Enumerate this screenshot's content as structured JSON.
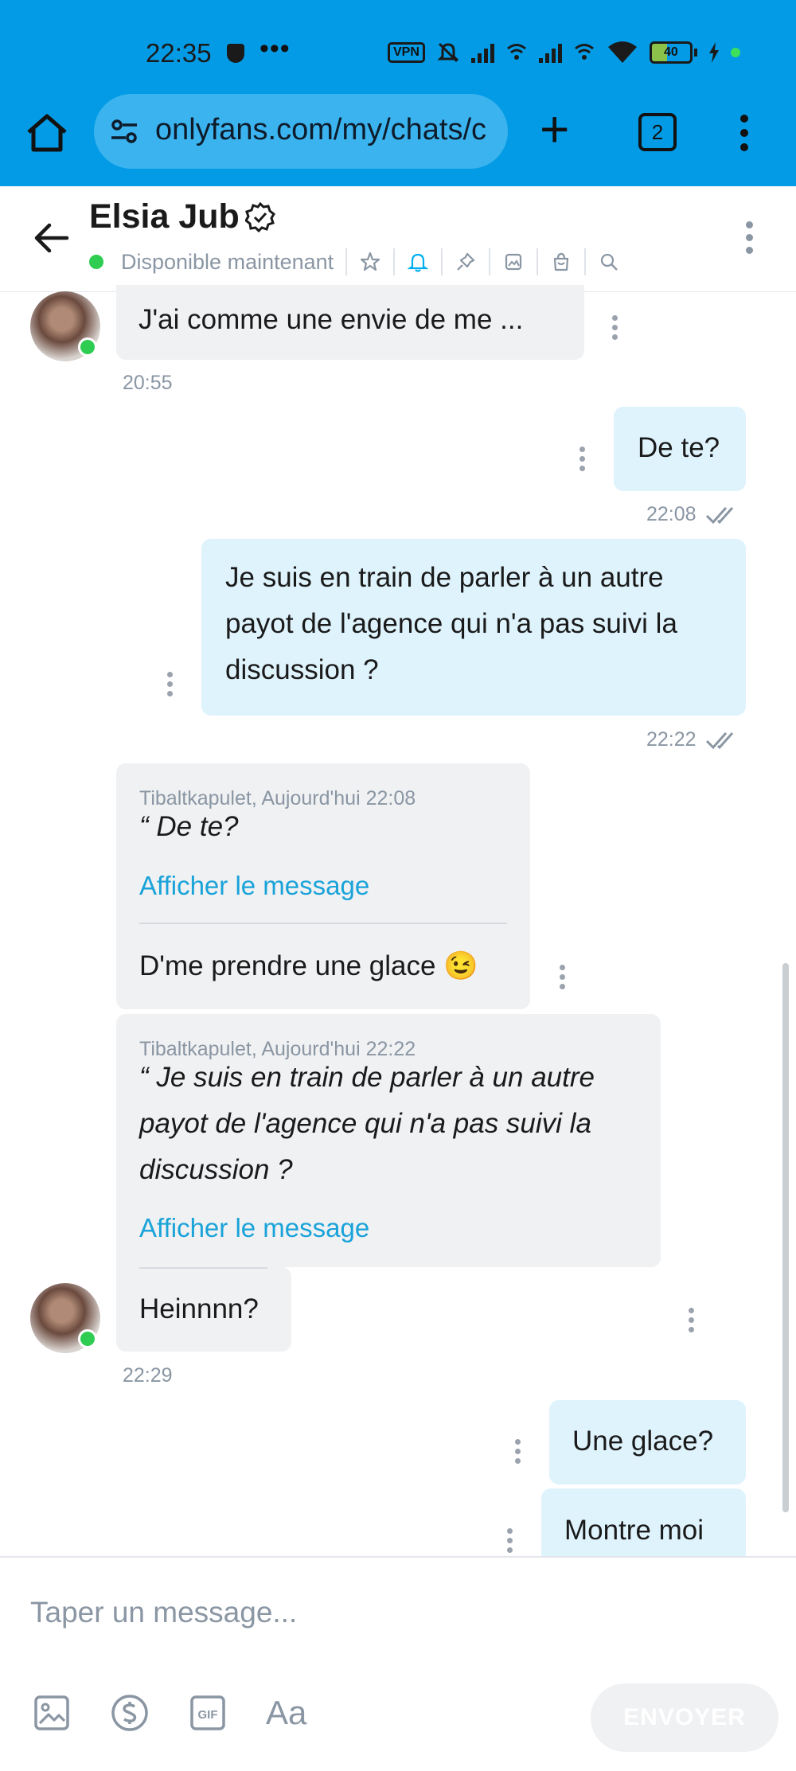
{
  "status_bar": {
    "time": "22:35",
    "dots": "•••",
    "vpn_label": "VPN",
    "battery_level": "40",
    "battery_fraction": 0.4
  },
  "browser": {
    "url": "onlyfans.com/my/chats/c",
    "tab_count": "2"
  },
  "chat_header": {
    "name": "Elsia Jub",
    "status": "Disponible maintenant",
    "tools": [
      "star-icon",
      "bell-icon",
      "pin-icon",
      "image-icon",
      "bag-icon",
      "search-icon"
    ],
    "accent_color": "#00aff0"
  },
  "messages": [
    {
      "from": "them",
      "text": "J'ai comme une envie de me ...",
      "time": "20:55"
    },
    {
      "from": "me",
      "text": "De te?",
      "time": "22:08"
    },
    {
      "from": "me",
      "lines": [
        "Je suis en train de parler à un autre",
        "payot de l'agence qui n'a pas suivi la",
        "discussion ?"
      ],
      "time": "22:22"
    },
    {
      "from": "them",
      "quote_meta": "Tibaltkapulet, Aujourd'hui 22:08",
      "quote_text": "“ De te?",
      "quote_link": "Afficher le message",
      "text": "D'me prendre une glace 😉"
    },
    {
      "from": "them",
      "quote_meta": "Tibaltkapulet, Aujourd'hui 22:22",
      "quote_lines": [
        "“ Je suis en train de parler à un autre",
        "payot de l'agence qui n'a pas suivi la",
        "discussion ?"
      ],
      "quote_link": "Afficher le message",
      "text": "Heinnnn?",
      "time": "22:29"
    },
    {
      "from": "me",
      "text": "Une glace?"
    },
    {
      "from": "me",
      "text": "Montre moi"
    }
  ],
  "composer": {
    "placeholder": "Taper un message...",
    "text_format_label": "Aa",
    "gif_label": "GIF",
    "send_label": "ENVOYER"
  }
}
